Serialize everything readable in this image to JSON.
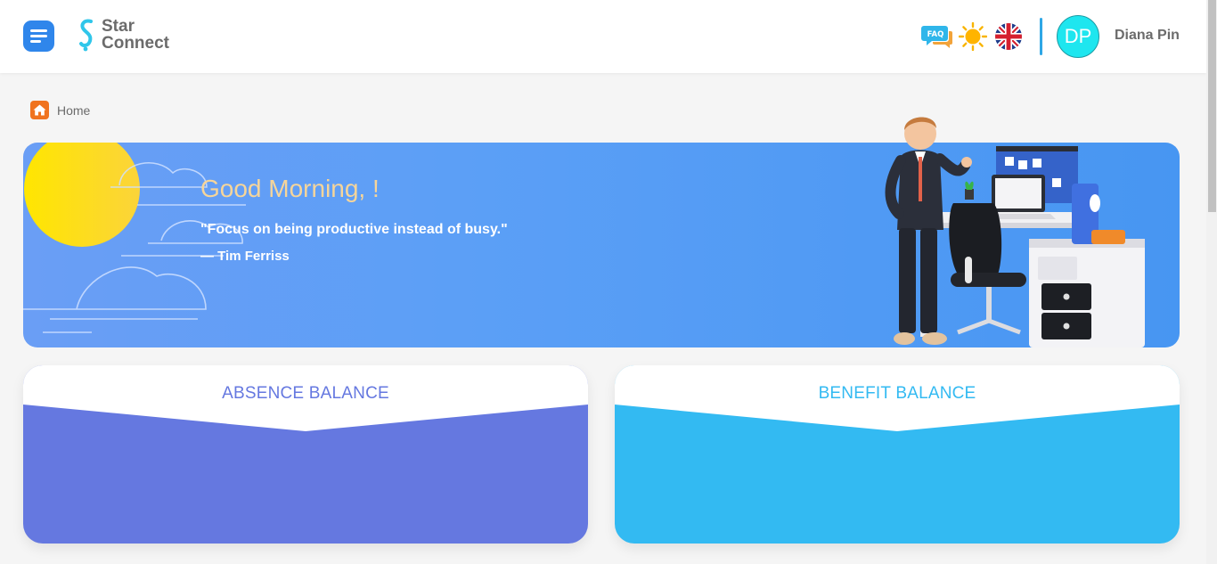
{
  "header": {
    "brand_line1": "Star",
    "brand_line2": "Connect",
    "faq_label": "FAQ",
    "user_initials": "DP",
    "user_name": "Diana Pin"
  },
  "breadcrumb": {
    "home_label": "Home"
  },
  "banner": {
    "greeting": "Good Morning, !",
    "quote": "\"Focus on being productive instead of busy.\"",
    "author": "—  Tim Ferriss"
  },
  "cards": {
    "absence_title": "ABSENCE BALANCE",
    "benefit_title": "BENEFIT BALANCE"
  },
  "colors": {
    "brand_blue": "#2f86eb",
    "absence": "#6578e0",
    "benefit": "#33baf2",
    "home_icon": "#f0731f",
    "avatar": "#1ee6ef"
  },
  "icons": [
    "menu-icon",
    "logo-icon",
    "faq-icon",
    "sun-icon",
    "uk-flag-icon",
    "home-icon"
  ]
}
